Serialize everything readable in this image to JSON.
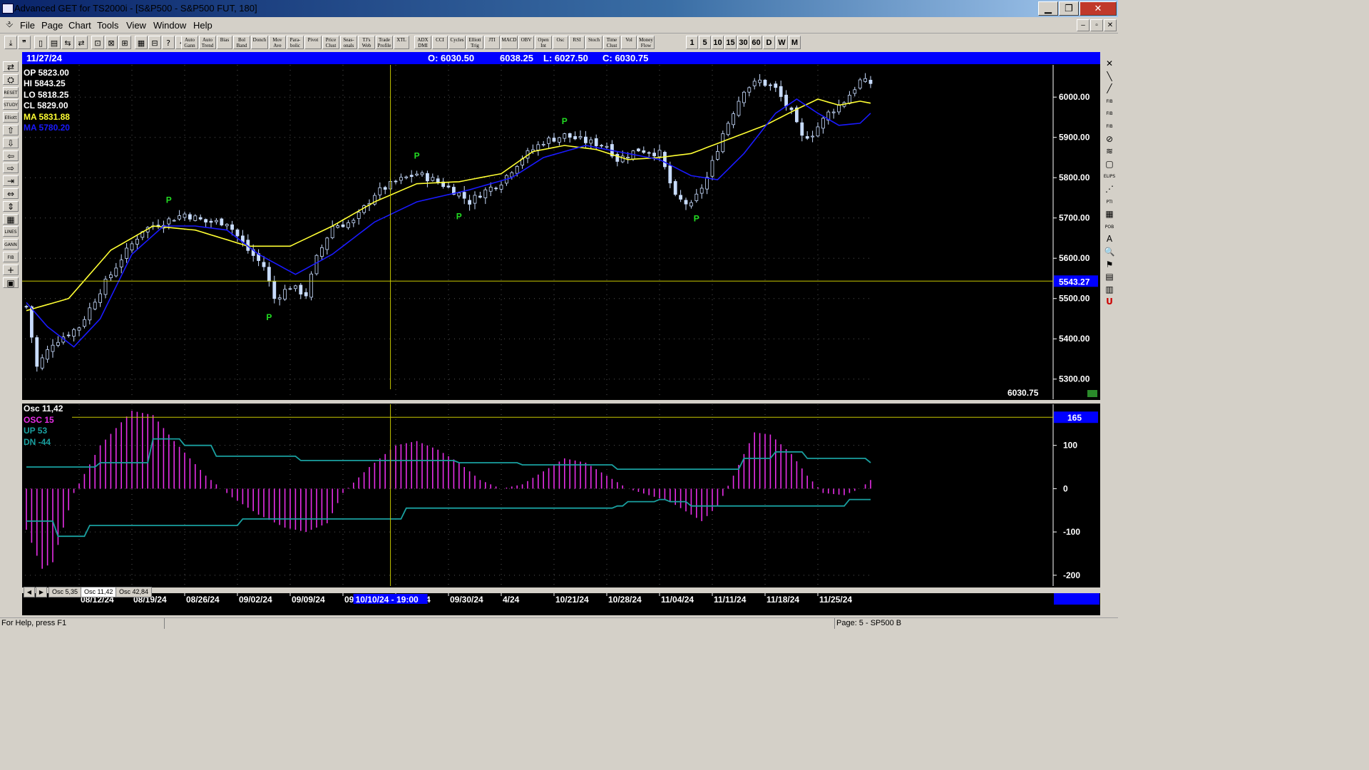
{
  "window": {
    "title": "Advanced GET for TS2000i - [S&P500 - S&P500 FUT, 180]",
    "minimize": "▁",
    "maximize": "❐",
    "close": "✕"
  },
  "menu": [
    "File",
    "Page",
    "Chart",
    "Tools",
    "View",
    "Window",
    "Help"
  ],
  "mdi_controls": [
    "–",
    "▫",
    "✕"
  ],
  "toolbar_icons": [
    "⤓",
    "❞",
    "▯",
    "▤",
    "⇆",
    "⇄",
    "⊡",
    "⊠",
    "⊞",
    "▦",
    "⊟",
    "?",
    "⌖"
  ],
  "toolbar_studies": [
    "Auto Gann",
    "Auto Trend",
    "Bias",
    "Bol Band",
    "Donch",
    "Mov Ave",
    "Para- bolic",
    "Pivot",
    "Price Clust",
    "Seas- onals",
    "TJ's Web",
    "Trade Profile",
    "XTL",
    "ADX DMI",
    "CCI",
    "Cycles",
    "Elliott Trig",
    "JTI",
    "MACD",
    "OBV",
    "Open Int",
    "Osc",
    "RSI",
    "Stoch",
    "Time Clust",
    "Vol",
    "Money Flow"
  ],
  "toolbar_periods": [
    "1",
    "5",
    "10",
    "15",
    "30",
    "60",
    "D",
    "W",
    "M"
  ],
  "left_tools": [
    "⇄",
    "⛭",
    "RESET",
    "STUDY",
    "Elliott",
    "⇧",
    "⇩",
    "⇦",
    "⇨",
    "⇥",
    "⇔",
    "⇕",
    "▦",
    "LINES",
    "GANN",
    "FIB",
    "+",
    "▣"
  ],
  "right_tools": [
    "✕",
    "╲",
    "╱",
    "FIB RET",
    "FIB EXT",
    "FIB TIME",
    "⊘",
    "≋",
    "▢",
    "ELIPS",
    "⋰",
    "PTI",
    "▦",
    "POB",
    "A",
    "🔍",
    "⚑",
    "▤",
    "▥",
    "U"
  ],
  "infobar": {
    "date": "11/27/24",
    "open": "O: 6030.50",
    "high": "6038.25",
    "low": "L: 6027.50",
    "close": "C: 6030.75"
  },
  "ohlc_panel": {
    "op": "OP  5823.00",
    "hi": "HI   5843.25",
    "lo": "LO  5818.25",
    "cl": "CL  5829.00",
    "ma1": "MA  5831.88",
    "ma2": "MA  5780.20"
  },
  "osc_panel": {
    "title": "Osc 11,42",
    "osc": "OSC 15",
    "up": "UP   53",
    "dn": "DN   -44"
  },
  "osc_tabs": [
    "Osc 5,35",
    "Osc 11,42",
    "Osc 42,84"
  ],
  "status": {
    "left": "For Help, press F1",
    "right": "Page: 5 - SP500 B"
  },
  "colors": {
    "ma_fast": "#ffff33",
    "ma_slow": "#1a1aff",
    "candle": "#c8dcff",
    "pivot": "#22dd22",
    "osc_bar": "#e62ee6",
    "band": "#1aa0a0",
    "crosshair": "#c8c800"
  },
  "chart_data": {
    "type": "line",
    "price_axis": {
      "ticks": [
        "6000.00",
        "5900.00",
        "5800.00",
        "5700.00",
        "5600.00",
        "5500.00",
        "5400.00",
        "5300.00"
      ],
      "ylim": [
        5250,
        6080
      ],
      "crosshair_value": "5543.27",
      "last_price": "6030.75"
    },
    "osc_axis": {
      "ticks": [
        "100",
        "0",
        "-100",
        "-200"
      ],
      "ylim": [
        -225,
        195
      ],
      "crosshair_value": "165"
    },
    "date_axis": {
      "labels": [
        "08/12/24",
        "08/19/24",
        "08/26/24",
        "09/02/24",
        "09/09/24",
        "09/16/24",
        "09/23/24",
        "09/30/24",
        "4/24",
        "10/21/24",
        "10/28/24",
        "11/04/24",
        "11/11/24",
        "11/18/24",
        "11/25/24"
      ],
      "crosshair_label": "10/10/24 - 19:00"
    },
    "pivots": [
      {
        "label": "P",
        "bar": 27,
        "price": 5720,
        "position": "above"
      },
      {
        "label": "P",
        "bar": 46,
        "price": 5475,
        "position": "below"
      },
      {
        "label": "P",
        "bar": 74,
        "price": 5830,
        "position": "above"
      },
      {
        "label": "P",
        "bar": 82,
        "price": 5725,
        "position": "below"
      },
      {
        "label": "P",
        "bar": 102,
        "price": 5915,
        "position": "above"
      },
      {
        "label": "P",
        "bar": 127,
        "price": 5720,
        "position": "below"
      }
    ],
    "close_anchors": [
      [
        0,
        5480
      ],
      [
        2,
        5330
      ],
      [
        5,
        5390
      ],
      [
        10,
        5430
      ],
      [
        14,
        5520
      ],
      [
        18,
        5600
      ],
      [
        22,
        5670
      ],
      [
        26,
        5690
      ],
      [
        30,
        5710
      ],
      [
        34,
        5690
      ],
      [
        38,
        5690
      ],
      [
        42,
        5620
      ],
      [
        45,
        5580
      ],
      [
        47,
        5500
      ],
      [
        50,
        5530
      ],
      [
        53,
        5510
      ],
      [
        55,
        5600
      ],
      [
        58,
        5680
      ],
      [
        62,
        5690
      ],
      [
        66,
        5760
      ],
      [
        70,
        5790
      ],
      [
        74,
        5810
      ],
      [
        78,
        5790
      ],
      [
        82,
        5760
      ],
      [
        84,
        5740
      ],
      [
        86,
        5760
      ],
      [
        90,
        5790
      ],
      [
        94,
        5850
      ],
      [
        98,
        5890
      ],
      [
        102,
        5905
      ],
      [
        106,
        5890
      ],
      [
        110,
        5880
      ],
      [
        112,
        5845
      ],
      [
        116,
        5870
      ],
      [
        120,
        5860
      ],
      [
        123,
        5750
      ],
      [
        126,
        5730
      ],
      [
        129,
        5800
      ],
      [
        132,
        5910
      ],
      [
        136,
        6020
      ],
      [
        139,
        6040
      ],
      [
        142,
        6020
      ],
      [
        145,
        5960
      ],
      [
        147,
        5900
      ],
      [
        149,
        5910
      ],
      [
        152,
        5960
      ],
      [
        155,
        5990
      ],
      [
        158,
        6040
      ],
      [
        160,
        6035
      ]
    ],
    "ma_fast_anchors": [
      [
        0,
        5470
      ],
      [
        8,
        5500
      ],
      [
        16,
        5620
      ],
      [
        24,
        5680
      ],
      [
        32,
        5670
      ],
      [
        42,
        5630
      ],
      [
        50,
        5630
      ],
      [
        58,
        5680
      ],
      [
        66,
        5740
      ],
      [
        74,
        5785
      ],
      [
        82,
        5790
      ],
      [
        90,
        5810
      ],
      [
        96,
        5865
      ],
      [
        102,
        5880
      ],
      [
        108,
        5870
      ],
      [
        114,
        5845
      ],
      [
        120,
        5850
      ],
      [
        126,
        5860
      ],
      [
        134,
        5900
      ],
      [
        140,
        5930
      ],
      [
        146,
        5970
      ],
      [
        150,
        5995
      ],
      [
        154,
        5980
      ],
      [
        158,
        5990
      ],
      [
        160,
        5985
      ]
    ],
    "ma_slow_anchors": [
      [
        0,
        5490
      ],
      [
        4,
        5430
      ],
      [
        9,
        5380
      ],
      [
        14,
        5450
      ],
      [
        20,
        5610
      ],
      [
        26,
        5680
      ],
      [
        32,
        5680
      ],
      [
        38,
        5670
      ],
      [
        44,
        5610
      ],
      [
        51,
        5560
      ],
      [
        58,
        5610
      ],
      [
        66,
        5690
      ],
      [
        74,
        5740
      ],
      [
        84,
        5770
      ],
      [
        92,
        5800
      ],
      [
        98,
        5850
      ],
      [
        106,
        5880
      ],
      [
        114,
        5860
      ],
      [
        120,
        5845
      ],
      [
        126,
        5805
      ],
      [
        131,
        5795
      ],
      [
        136,
        5860
      ],
      [
        142,
        5960
      ],
      [
        146,
        5995
      ],
      [
        150,
        5960
      ],
      [
        154,
        5930
      ],
      [
        158,
        5935
      ],
      [
        160,
        5960
      ]
    ],
    "osc_anchors": [
      [
        0,
        -95
      ],
      [
        3,
        -185
      ],
      [
        5,
        -170
      ],
      [
        9,
        -10
      ],
      [
        14,
        100
      ],
      [
        20,
        180
      ],
      [
        24,
        170
      ],
      [
        28,
        110
      ],
      [
        34,
        30
      ],
      [
        39,
        -20
      ],
      [
        44,
        -60
      ],
      [
        49,
        -90
      ],
      [
        53,
        -100
      ],
      [
        57,
        -80
      ],
      [
        60,
        -10
      ],
      [
        65,
        50
      ],
      [
        70,
        100
      ],
      [
        74,
        110
      ],
      [
        78,
        90
      ],
      [
        82,
        60
      ],
      [
        86,
        20
      ],
      [
        90,
        0
      ],
      [
        94,
        10
      ],
      [
        98,
        40
      ],
      [
        102,
        70
      ],
      [
        106,
        60
      ],
      [
        110,
        30
      ],
      [
        114,
        0
      ],
      [
        118,
        -15
      ],
      [
        122,
        -30
      ],
      [
        126,
        -60
      ],
      [
        128,
        -75
      ],
      [
        131,
        -40
      ],
      [
        134,
        30
      ],
      [
        138,
        130
      ],
      [
        141,
        125
      ],
      [
        145,
        80
      ],
      [
        148,
        30
      ],
      [
        151,
        -10
      ],
      [
        155,
        -15
      ],
      [
        158,
        0
      ],
      [
        160,
        20
      ]
    ],
    "band_up_steps": [
      [
        0,
        50
      ],
      [
        11,
        50
      ],
      [
        14,
        60
      ],
      [
        24,
        115
      ],
      [
        30,
        100
      ],
      [
        36,
        75
      ],
      [
        50,
        75
      ],
      [
        52,
        65
      ],
      [
        72,
        65
      ],
      [
        82,
        60
      ],
      [
        90,
        60
      ],
      [
        94,
        55
      ],
      [
        110,
        55
      ],
      [
        112,
        45
      ],
      [
        126,
        45
      ],
      [
        130,
        45
      ],
      [
        136,
        70
      ],
      [
        142,
        85
      ],
      [
        148,
        70
      ],
      [
        158,
        70
      ],
      [
        160,
        60
      ]
    ],
    "band_dn_steps": [
      [
        0,
        -75
      ],
      [
        6,
        -110
      ],
      [
        12,
        -85
      ],
      [
        38,
        -85
      ],
      [
        41,
        -70
      ],
      [
        56,
        -70
      ],
      [
        58,
        -70
      ],
      [
        62,
        -70
      ],
      [
        72,
        -45
      ],
      [
        76,
        -45
      ],
      [
        84,
        -45
      ],
      [
        90,
        -45
      ],
      [
        112,
        -40
      ],
      [
        114,
        -30
      ],
      [
        120,
        -25
      ],
      [
        122,
        -30
      ],
      [
        126,
        -40
      ],
      [
        136,
        -40
      ],
      [
        148,
        -40
      ],
      [
        156,
        -25
      ],
      [
        160,
        -25
      ]
    ],
    "bar_count": 161
  }
}
